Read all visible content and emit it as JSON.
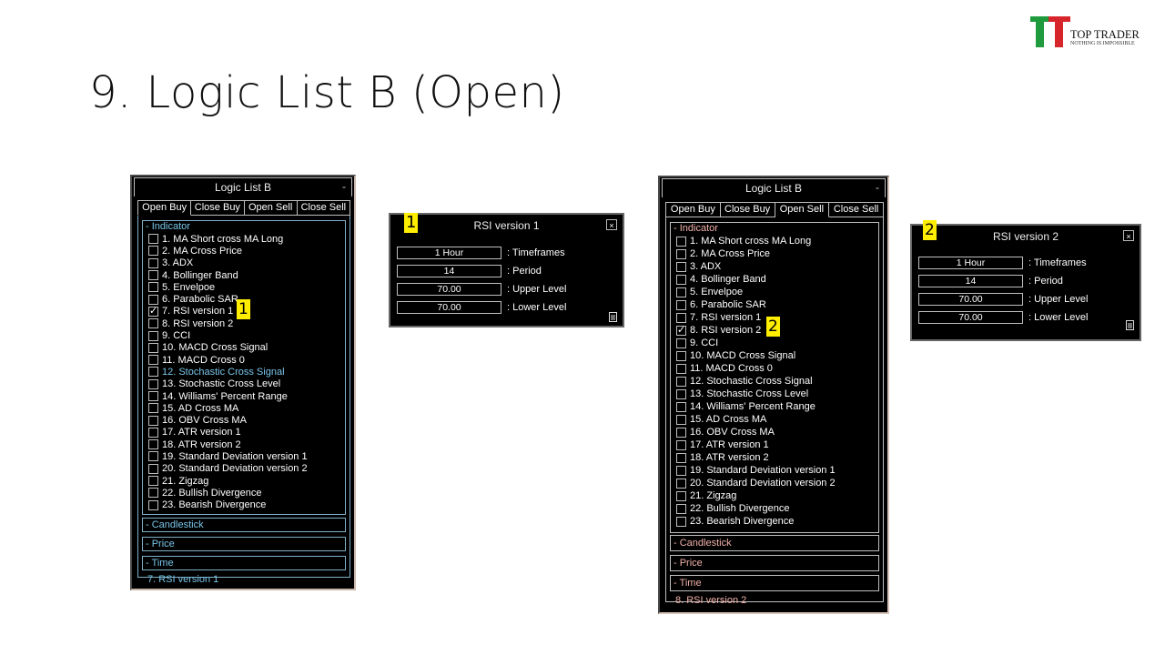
{
  "slide": {
    "title": "9. Logic List B (Open)"
  },
  "brand": {
    "name": "TOP TRADER",
    "tagline": "NOTHING IS IMPOSSIBLE",
    "colors": {
      "green": "#1f9a3c",
      "red": "#d7262b"
    }
  },
  "panels": [
    {
      "title": "Logic List B",
      "minimize": "-",
      "tabs": [
        "Open Buy",
        "Close Buy",
        "Open Sell",
        "Close Sell"
      ],
      "active_tab": 0,
      "section": "- Indicator",
      "items": [
        "1. MA Short cross MA Long",
        "2. MA Cross Price",
        "3. ADX",
        "4. Bollinger Band",
        "5. Envelpoe",
        "6. Parabolic SAR",
        "7. RSI version 1",
        "8. RSI version 2",
        "9. CCI",
        "10. MACD Cross Signal",
        "11. MACD Cross 0",
        "12. Stochastic Cross Signal",
        "13. Stochastic Cross Level",
        "14. Williams' Percent Range",
        "15. AD Cross MA",
        "16. OBV Cross MA",
        "17. ATR version 1",
        "18. ATR version 2",
        "19. Standard Deviation version 1",
        "20. Standard Deviation version 2",
        "21. Zigzag",
        "22. Bullish Divergence",
        "23. Bearish Divergence"
      ],
      "checked_index": 6,
      "highlighted_index": 11,
      "collapsed": [
        "- Candlestick",
        "- Price",
        "- Time"
      ],
      "status": "7. RSI version 1",
      "marker": "1"
    },
    {
      "title": "Logic List B",
      "minimize": "-",
      "tabs": [
        "Open Buy",
        "Close Buy",
        "Open Sell",
        "Close Sell"
      ],
      "active_tab": 2,
      "section": "- Indicator",
      "items": [
        "1. MA Short cross MA Long",
        "2. MA Cross Price",
        "3. ADX",
        "4. Bollinger Band",
        "5. Envelpoe",
        "6. Parabolic SAR",
        "7. RSI version 1",
        "8. RSI version 2",
        "9. CCI",
        "10. MACD Cross Signal",
        "11. MACD Cross 0",
        "12. Stochastic Cross Signal",
        "13. Stochastic Cross Level",
        "14. Williams' Percent Range",
        "15. AD Cross MA",
        "16. OBV Cross MA",
        "17. ATR version 1",
        "18. ATR version 2",
        "19. Standard Deviation version 1",
        "20. Standard Deviation version 2",
        "21. Zigzag",
        "22. Bullish Divergence",
        "23. Bearish Divergence"
      ],
      "checked_index": 7,
      "highlighted_index": -1,
      "collapsed": [
        "- Candlestick",
        "- Price",
        "- Time"
      ],
      "status": "8. RSI version 2",
      "marker": "2"
    }
  ],
  "dialogs": [
    {
      "marker": "1",
      "title": "RSI version 1",
      "close": "×",
      "params": [
        {
          "value": "1 Hour",
          "label": ": Timeframes"
        },
        {
          "value": "14",
          "label": ": Period"
        },
        {
          "value": "70.00",
          "label": ": Upper Level"
        },
        {
          "value": "70.00",
          "label": ": Lower Level"
        }
      ]
    },
    {
      "marker": "2",
      "title": "RSI version 2",
      "close": "×",
      "params": [
        {
          "value": "1 Hour",
          "label": ": Timeframes"
        },
        {
          "value": "14",
          "label": ": Period"
        },
        {
          "value": "70.00",
          "label": ": Upper Level"
        },
        {
          "value": "70.00",
          "label": ": Lower Level"
        }
      ]
    }
  ]
}
